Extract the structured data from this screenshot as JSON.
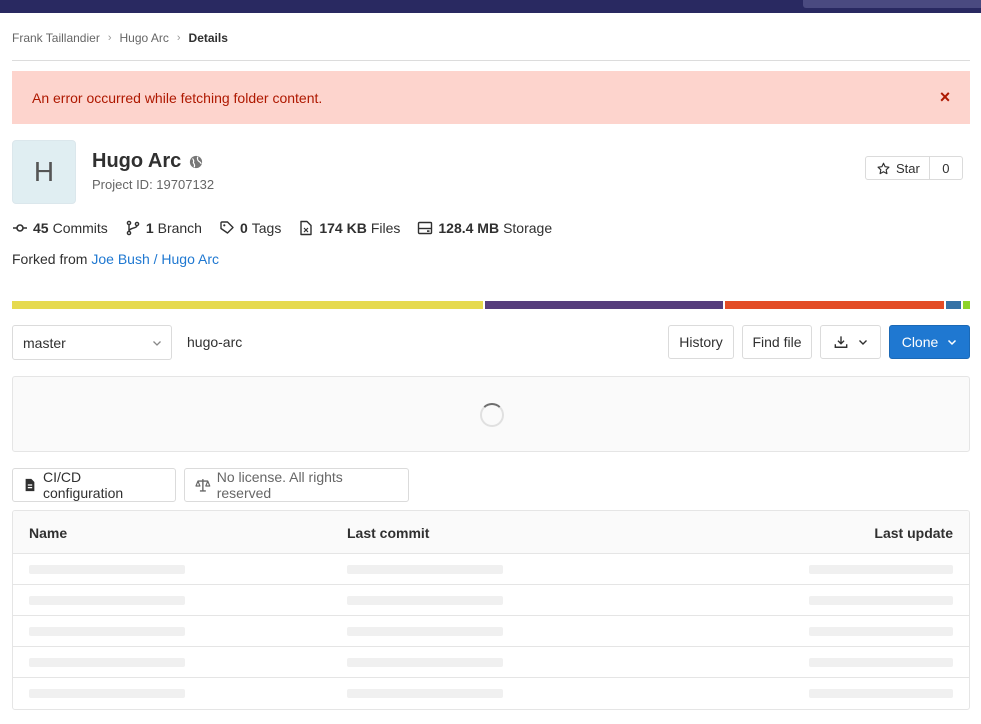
{
  "breadcrumb": {
    "items": [
      "Frank Taillandier",
      "Hugo Arc"
    ],
    "current": "Details"
  },
  "alert": {
    "message": "An error occurred while fetching folder content.",
    "close": "×"
  },
  "project": {
    "avatar_letter": "H",
    "name": "Hugo Arc",
    "id_text": "Project ID: 19707132",
    "star_label": "Star",
    "star_count": "0"
  },
  "stats": [
    {
      "value": "45",
      "label": "Commits",
      "icon": "commit-icon"
    },
    {
      "value": "1",
      "label": "Branch",
      "icon": "branch-icon"
    },
    {
      "value": "0",
      "label": "Tags",
      "icon": "tag-icon"
    },
    {
      "value": "174 KB",
      "label": "Files",
      "icon": "file-icon"
    },
    {
      "value": "128.4 MB",
      "label": "Storage",
      "icon": "storage-icon"
    }
  ],
  "fork": {
    "prefix": "Forked from",
    "source_namespace": "Joe Bush",
    "source_separator": "/",
    "source_project": "Hugo Arc"
  },
  "languages": [
    {
      "share": 49.3,
      "color": "#e6da4f"
    },
    {
      "share": 25.0,
      "color": "#563d7c"
    },
    {
      "share": 22.9,
      "color": "#e34c26"
    },
    {
      "share": 1.6,
      "color": "#3572a5"
    },
    {
      "share": 0.7,
      "color": "#8ed42b"
    }
  ],
  "repo": {
    "branch": "master",
    "path": "hugo-arc",
    "history_label": "History",
    "find_file_label": "Find file",
    "clone_label": "Clone"
  },
  "badges": {
    "ci_label": "CI/CD configuration",
    "license_label": "No license. All rights reserved"
  },
  "tree": {
    "columns": [
      "Name",
      "Last commit",
      "Last update"
    ],
    "loading_rows": 5
  },
  "colors": {
    "accent": "#1f78d1",
    "alert_bg": "#fdd4cd",
    "alert_text": "#ae1800",
    "topbar": "#292961"
  }
}
